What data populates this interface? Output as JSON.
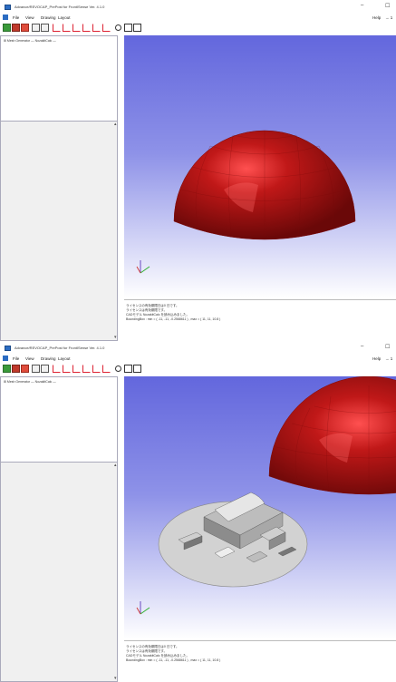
{
  "app": {
    "title": "Advance/REVOCAP_PrePost for FrontISense Ver. 4.1.0",
    "minimize_glyph": "–",
    "maximize_glyph": "☐"
  },
  "menu": {
    "file": "File",
    "view": "View",
    "drawing": "Drawing",
    "layout": "Layout",
    "help": "Help",
    "extra": "→ 1"
  },
  "tree": {
    "root": "⊞ Mesh Generator — NozakitCalc —"
  },
  "console": {
    "lines": [
      "ライセンスの有効期限日は0 日です。",
      "ライセンスは有効期限です。",
      "CADモデル NozakitCalc を読み込みました。",
      "BoundingBox : min = ( -11, -11, -0.2568611 ) ,  max = ( 11, 11, 10.8 )"
    ]
  },
  "colors": {
    "dome": "#b01818",
    "viewport_top": "#6367dd",
    "building": "#c8c8c8"
  },
  "icons": [
    "app-icon",
    "toolbar-icons",
    "axis-triad-icon"
  ]
}
